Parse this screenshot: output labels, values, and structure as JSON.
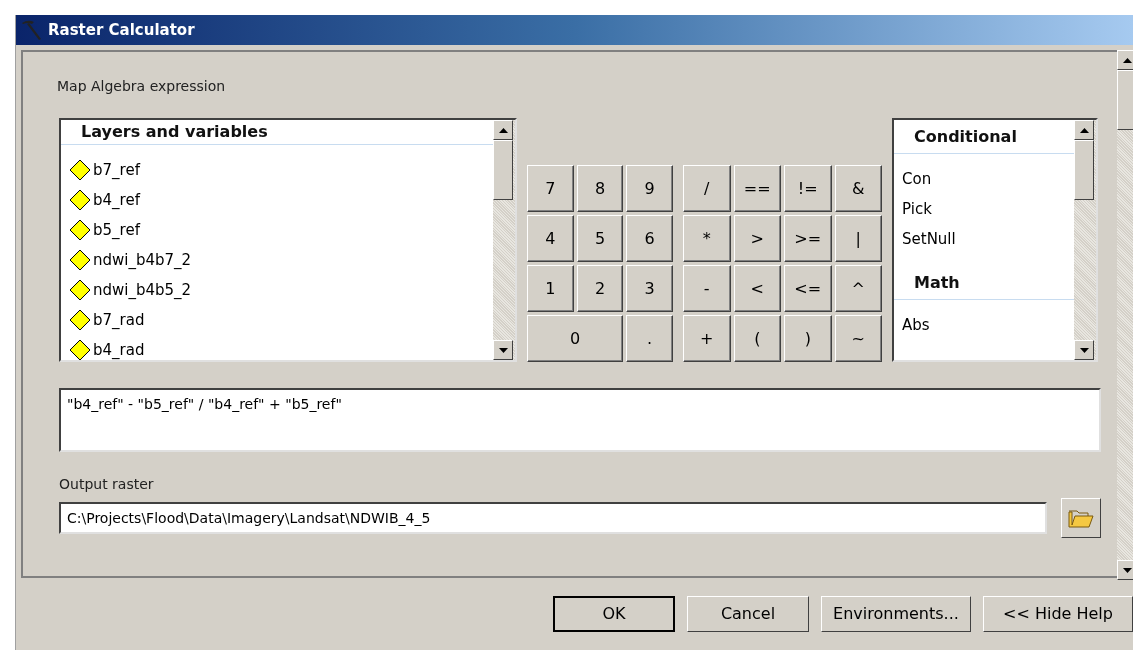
{
  "window": {
    "title": "Raster Calculator"
  },
  "expression_label": "Map Algebra expression",
  "layers": {
    "heading": "Layers and variables",
    "items": [
      "b7_ref",
      "b4_ref",
      "b5_ref",
      "ndwi_b4b7_2",
      "ndwi_b4b5_2",
      "b7_rad",
      "b4_rad"
    ]
  },
  "keypad": {
    "digits": [
      [
        "7",
        "8",
        "9"
      ],
      [
        "4",
        "5",
        "6"
      ],
      [
        "1",
        "2",
        "3"
      ],
      [
        "0",
        "."
      ]
    ],
    "operators": [
      [
        "/",
        "==",
        "!=",
        "&"
      ],
      [
        "*",
        ">",
        ">=",
        "|"
      ],
      [
        "-",
        "<",
        "<=",
        "^"
      ],
      [
        "+",
        "(",
        ")",
        "~"
      ]
    ]
  },
  "functions": [
    {
      "heading": "Conditional",
      "items": [
        "Con",
        "Pick",
        "SetNull"
      ]
    },
    {
      "heading": "Math",
      "items": [
        "Abs"
      ]
    }
  ],
  "expression": "\"b4_ref\" - \"b5_ref\" / \"b4_ref\" + \"b5_ref\"",
  "output": {
    "label": "Output raster",
    "value": "C:\\Projects\\Flood\\Data\\Imagery\\Landsat\\NDWIB_4_5"
  },
  "buttons": [
    "OK",
    "Cancel",
    "Environments...",
    "<< Hide Help"
  ]
}
